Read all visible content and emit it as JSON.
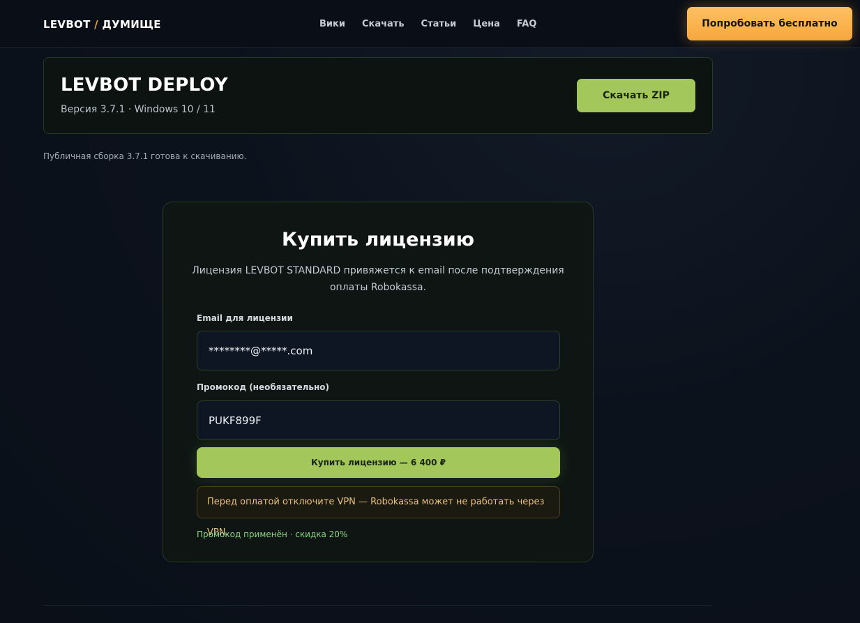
{
  "header": {
    "logo_left": "LEVBOT",
    "logo_slash": "/",
    "logo_right": "ДУМИЩЕ",
    "nav": [
      "Вики",
      "Скачать",
      "Статьи",
      "Цена",
      "FAQ"
    ],
    "cta_label": "Попробовать бесплатно"
  },
  "deploy": {
    "title": "LEVBOT DEPLOY",
    "subtitle": "Версия 3.7.1 · Windows 10 / 11",
    "download_label": "Скачать ZIP",
    "note": "Публичная сборка 3.7.1 готова к скачиванию."
  },
  "license": {
    "title": "Купить лицензию",
    "description": "Лицензия LEVBOT STANDARD привяжется к email после подтверждения оплаты Robokassa.",
    "email_label": "Email для лицензии",
    "email_value": "********@*****.com",
    "promo_label": "Промокод (необязательно)",
    "promo_value": "PUKF899F",
    "buy_label": "Купить лицензию — 6 400 ₽",
    "vpn_warning": "Перед оплатой отключите VPN — Robokassa может не работать через VPN.",
    "promo_status": "Промокод применён · скидка 20%"
  },
  "colors": {
    "accent_orange": "#f6a73d",
    "accent_green": "#a3c75a",
    "warning_text": "#e9c07a",
    "success_text": "#8fd586"
  }
}
